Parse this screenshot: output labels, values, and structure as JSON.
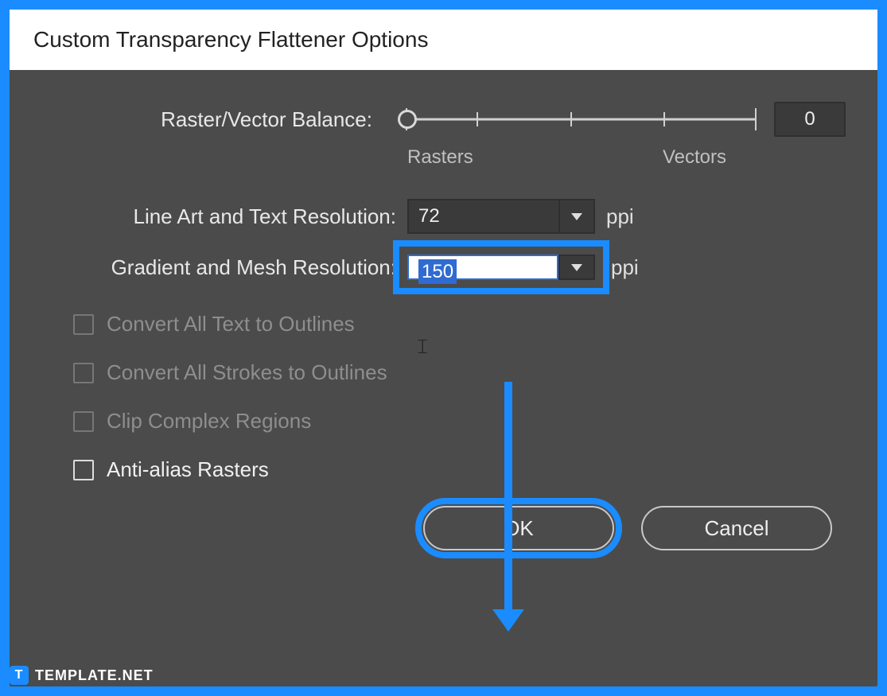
{
  "dialog": {
    "title": "Custom Transparency Flattener Options",
    "balance": {
      "label": "Raster/Vector Balance:",
      "value": "0",
      "left_label": "Rasters",
      "right_label": "Vectors"
    },
    "line_art": {
      "label": "Line Art and Text Resolution:",
      "value": "72",
      "unit": "ppi"
    },
    "gradient": {
      "label": "Gradient and Mesh Resolution:",
      "value": "150",
      "unit": "ppi"
    },
    "checks": {
      "convert_text": "Convert All Text to Outlines",
      "convert_strokes": "Convert All Strokes to Outlines",
      "clip": "Clip Complex Regions",
      "anti_alias": "Anti-alias Rasters"
    },
    "buttons": {
      "ok": "OK",
      "cancel": "Cancel"
    }
  },
  "watermark": {
    "icon": "T",
    "text": "TEMPLATE.NET"
  },
  "colors": {
    "highlight": "#1a8cff",
    "dialog_bg": "#4b4b4b"
  }
}
